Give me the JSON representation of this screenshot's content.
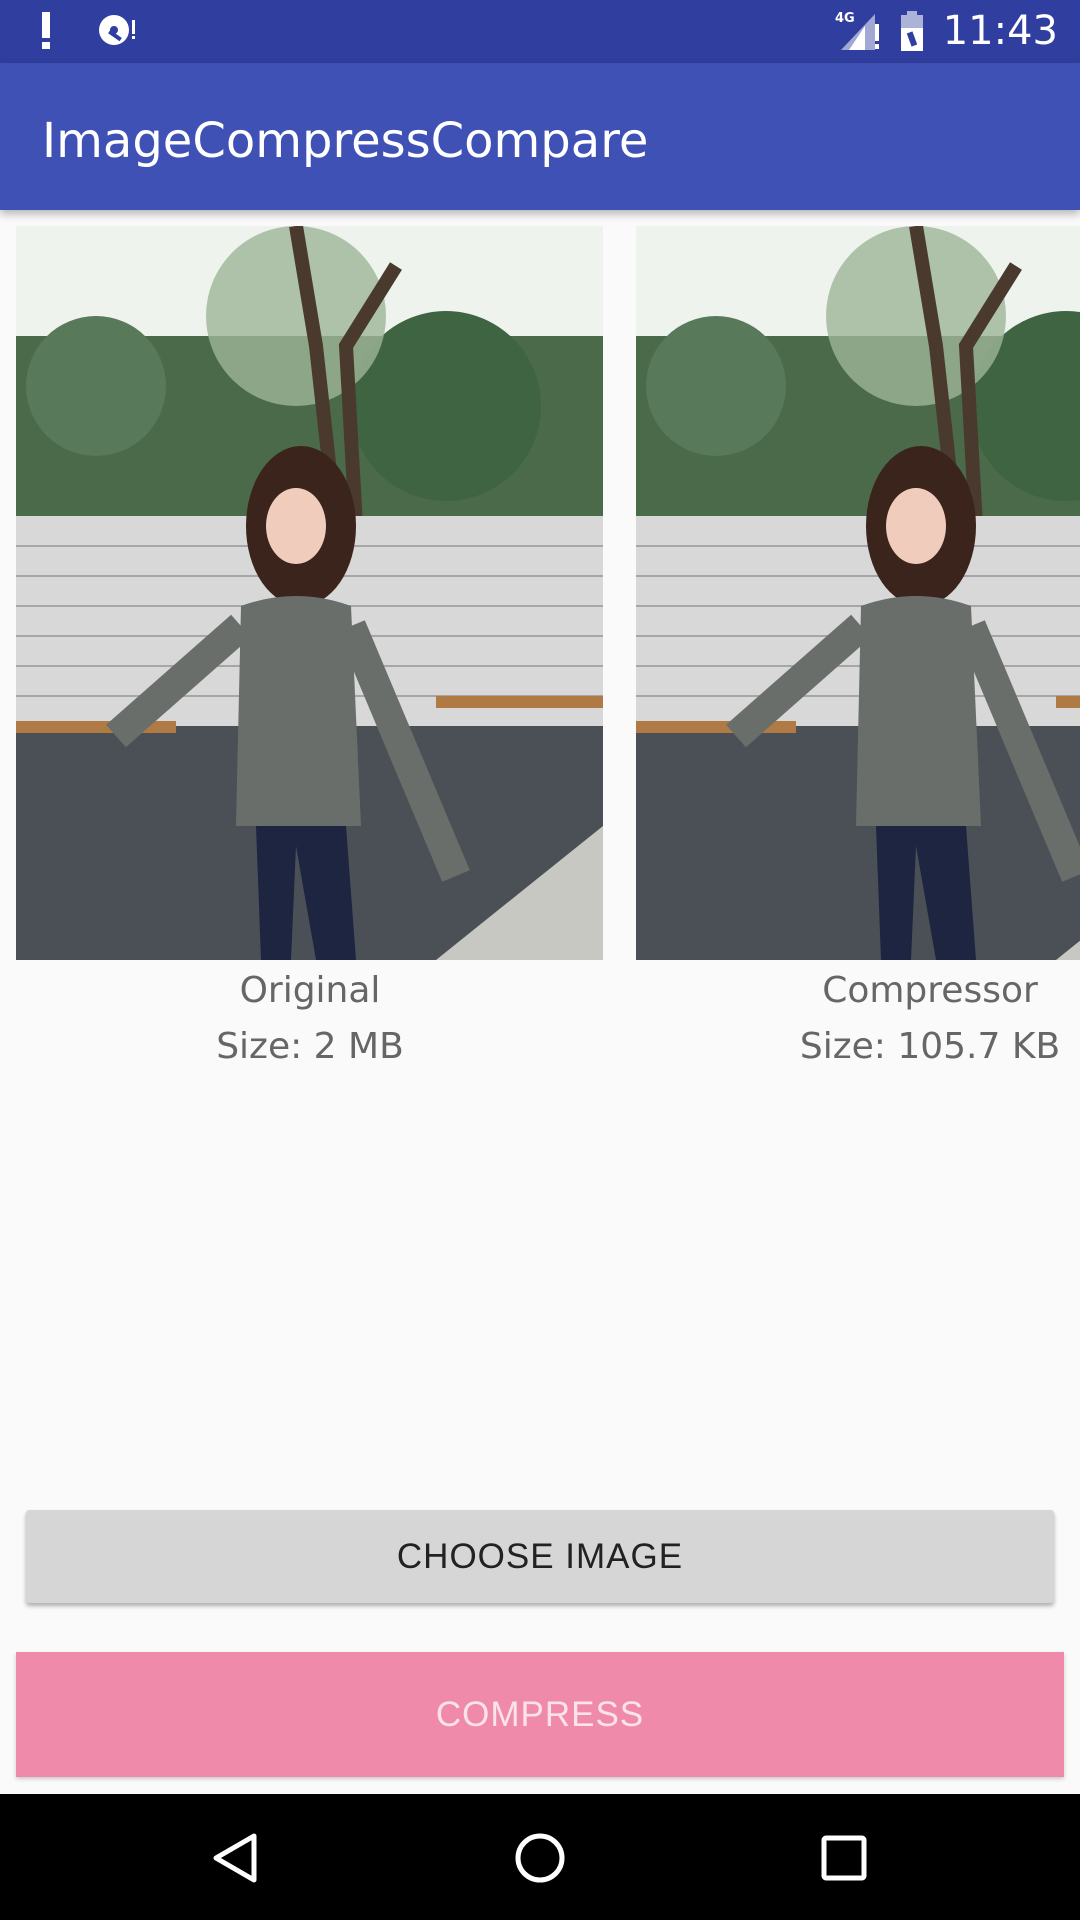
{
  "status_bar": {
    "time": "11:43",
    "network_label": "4G",
    "icons": [
      "alert-icon",
      "sd-card-icon",
      "signal-icon",
      "battery-icon"
    ]
  },
  "app_bar": {
    "title": "ImageCompressCompare"
  },
  "images": {
    "original": {
      "label": "Original",
      "size": "Size: 2 MB"
    },
    "compressed": {
      "label": "Compressor",
      "size": "Size: 105.7 KB"
    }
  },
  "buttons": {
    "choose_image": "CHOOSE IMAGE",
    "compress": "COMPRESS"
  },
  "nav_bar": {
    "icons": [
      "back-icon",
      "home-icon",
      "recents-icon"
    ]
  },
  "colors": {
    "status_bar": "#303f9f",
    "app_bar": "#3f51b5",
    "compress_button": "#ef8aab",
    "choose_button": "#d6d6d6"
  }
}
